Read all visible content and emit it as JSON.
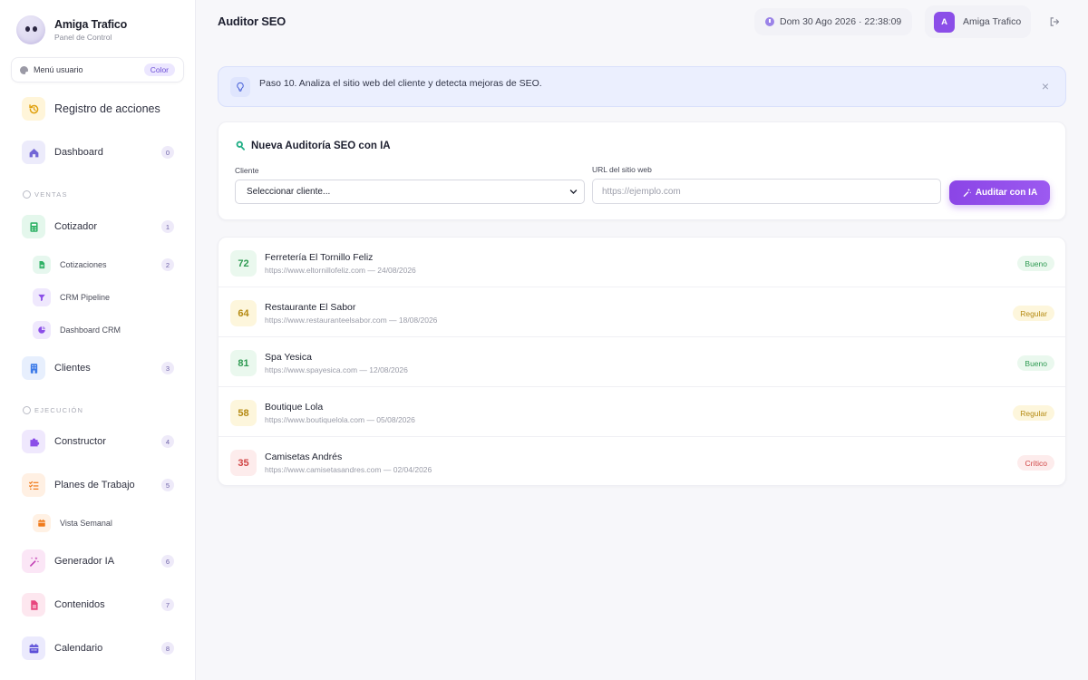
{
  "brand": {
    "name": "Amiga Trafico",
    "subtitle": "Panel de Control"
  },
  "user_menu": {
    "label": "Menú usuario",
    "badge": "Color"
  },
  "sidebar": {
    "top_items": [
      {
        "label": "Registro de acciones",
        "icon": "history-icon"
      },
      {
        "label": "Dashboard",
        "icon": "home-icon",
        "badge": "0"
      }
    ],
    "sections": {
      "ventas": "VENTAS",
      "ejecucion": "EJECUCIÓN"
    },
    "ventas_items": [
      {
        "label": "Cotizador",
        "icon": "calculator-icon",
        "badge": "1"
      },
      {
        "label": "Cotizaciones",
        "icon": "document-icon",
        "badge": "2",
        "sub": true
      },
      {
        "label": "CRM Pipeline",
        "icon": "funnel-icon",
        "sub": true
      },
      {
        "label": "Dashboard CRM",
        "icon": "pie-chart-icon",
        "sub": true
      },
      {
        "label": "Clientes",
        "icon": "building-icon",
        "badge": "3"
      }
    ],
    "ejecucion_items": [
      {
        "label": "Constructor",
        "icon": "puzzle-icon",
        "badge": "4"
      },
      {
        "label": "Planes de Trabajo",
        "icon": "list-check-icon",
        "badge": "5"
      },
      {
        "label": "Vista Semanal",
        "icon": "calendar-week-icon",
        "sub": true
      },
      {
        "label": "Generador IA",
        "icon": "magic-wand-icon",
        "badge": "6"
      },
      {
        "label": "Contenidos",
        "icon": "file-icon",
        "badge": "7"
      },
      {
        "label": "Calendario",
        "icon": "calendar-icon",
        "badge": "8"
      }
    ]
  },
  "header": {
    "title": "Auditor SEO",
    "datetime": "Dom 30 Ago 2026 · 22:38:09",
    "user_initial": "A",
    "user_name": "Amiga Trafico"
  },
  "hint": {
    "text": "Paso 10. Analiza el sitio web del cliente y detecta mejoras de SEO.",
    "close": "×"
  },
  "form": {
    "title": "Nueva Auditoría SEO con IA",
    "client_label": "Cliente",
    "client_value": "Seleccionar cliente...",
    "url_label": "URL del sitio web",
    "url_placeholder": "https://ejemplo.com",
    "url_value": "",
    "submit_label": "Auditar con IA"
  },
  "audits": [
    {
      "score": "72",
      "name": "Ferretería El Tornillo Feliz",
      "meta": "https://www.eltornillofeliz.com — 24/08/2026",
      "status": "Bueno",
      "level": "good"
    },
    {
      "score": "64",
      "name": "Restaurante El Sabor",
      "meta": "https://www.restauranteelsabor.com — 18/08/2026",
      "status": "Regular",
      "level": "regular"
    },
    {
      "score": "81",
      "name": "Spa Yesica",
      "meta": "https://www.spayesica.com — 12/08/2026",
      "status": "Bueno",
      "level": "good"
    },
    {
      "score": "58",
      "name": "Boutique Lola",
      "meta": "https://www.boutiquelola.com — 05/08/2026",
      "status": "Regular",
      "level": "regular"
    },
    {
      "score": "35",
      "name": "Camisetas Andrés",
      "meta": "https://www.camisetasandres.com — 02/04/2026",
      "status": "Crítico",
      "level": "critical"
    }
  ],
  "colors": {
    "accent": "#8b45e6",
    "good_bg": "#eaf8ee",
    "good_fg": "#2f9a52",
    "regular_bg": "#fdf6dc",
    "regular_fg": "#b58a12",
    "critical_bg": "#fdecec",
    "critical_fg": "#d04545"
  }
}
